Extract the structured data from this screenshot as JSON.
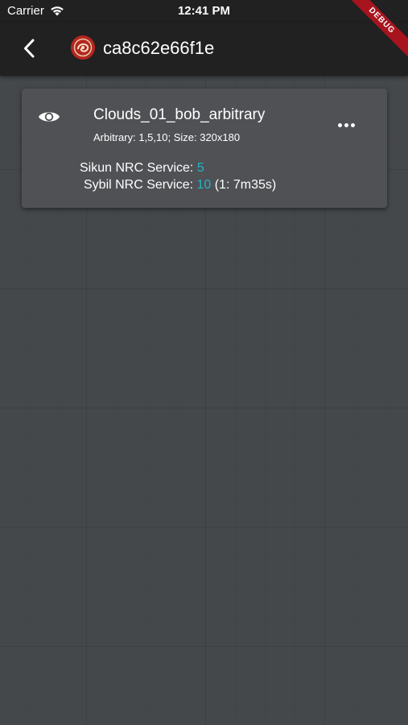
{
  "status_bar": {
    "carrier": "Carrier",
    "time": "12:41 PM",
    "wifi_icon": "wifi-icon"
  },
  "app_bar": {
    "title": "ca8c62e66f1e",
    "back_icon": "chevron-left-icon",
    "avatar_icon": "avatar-icon",
    "debug_label": "DEBUG"
  },
  "card": {
    "icon": "eye-icon",
    "title": "Clouds_01_bob_arbitrary",
    "subtitle": "Arbitrary: 1,5,10; Size: 320x180",
    "menu_icon": "more-horizontal-icon",
    "services": [
      {
        "label": "Sikun NRC Service: ",
        "value": "5",
        "extra": ""
      },
      {
        "label": "Sybil NRC Service: ",
        "value": "10",
        "extra": " (1: 7m35s)"
      }
    ]
  },
  "colors": {
    "accent": "#27b1c9",
    "background": "#45484b",
    "app_bar": "#212121",
    "card": "#4f5154",
    "debug_ribbon": "#a8141e"
  }
}
